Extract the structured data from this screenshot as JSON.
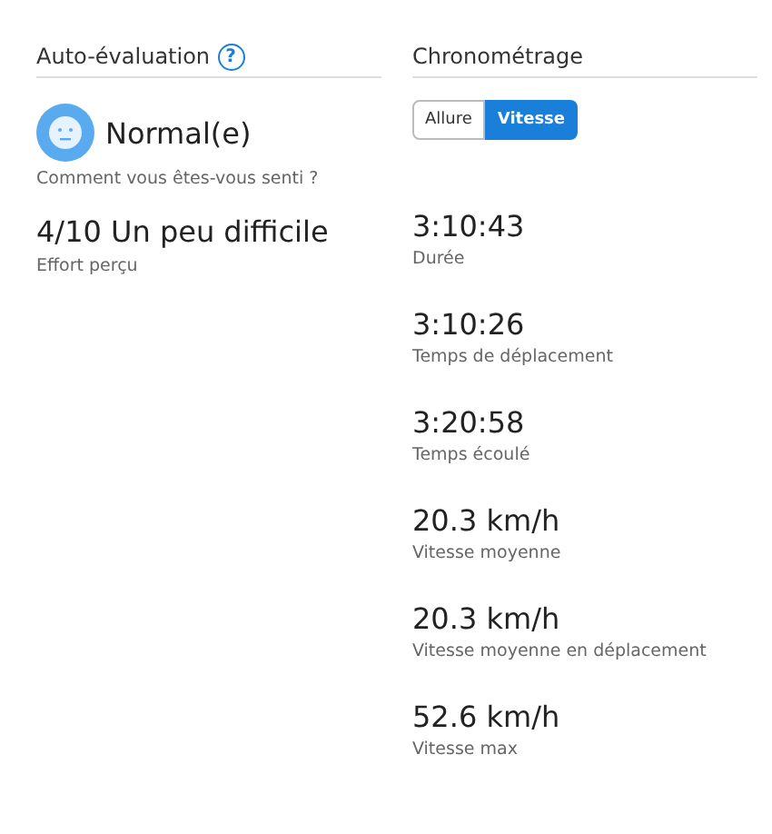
{
  "self_evaluation": {
    "title": "Auto-évaluation",
    "help_icon": "?",
    "feeling": "Normal(e)",
    "feeling_label": "Comment vous êtes-vous senti ?",
    "effort": "4/10 Un peu difficile",
    "effort_label": "Effort perçu"
  },
  "timing": {
    "title": "Chronométrage",
    "toggle": [
      {
        "label": "Allure",
        "selected": false
      },
      {
        "label": "Vitesse",
        "selected": true
      }
    ],
    "stats": [
      {
        "value": "3:10:43",
        "label": "Durée"
      },
      {
        "value": "3:10:26",
        "label": "Temps de déplacement"
      },
      {
        "value": "3:20:58",
        "label": "Temps écoulé"
      },
      {
        "value": "20.3 km/h",
        "label": "Vitesse moyenne"
      },
      {
        "value": "20.3 km/h",
        "label": "Vitesse moyenne en déplacement"
      },
      {
        "value": "52.6 km/h",
        "label": "Vitesse max"
      }
    ]
  }
}
